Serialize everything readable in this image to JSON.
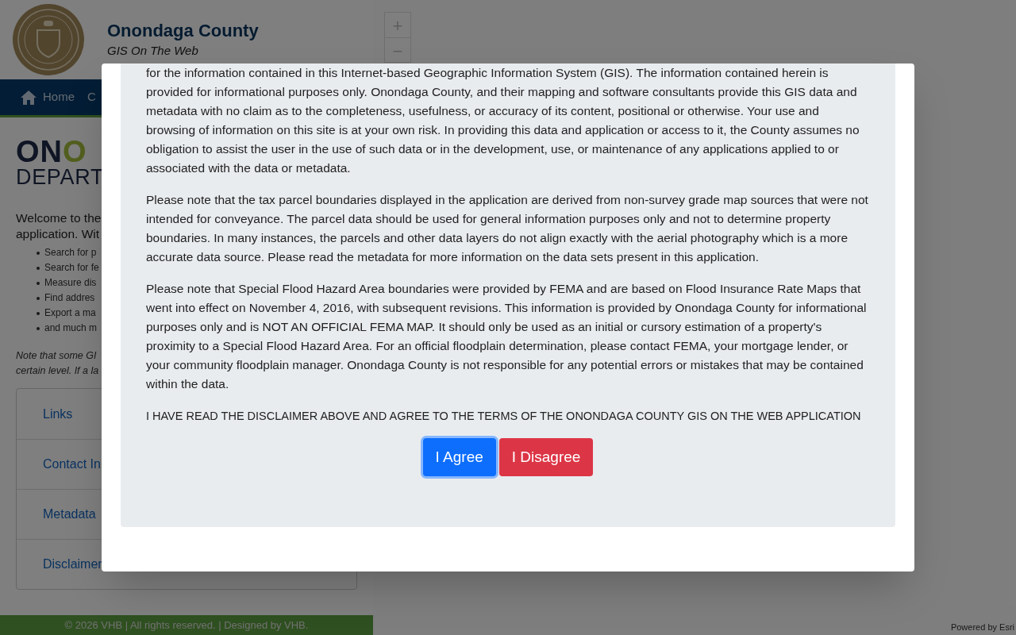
{
  "header": {
    "title": "Onondaga County",
    "subtitle": "GIS On The Web"
  },
  "nav": [
    "Home",
    "C"
  ],
  "map_zoom": [
    "+",
    "−"
  ],
  "sidebar": {
    "logo_parts": [
      "ON",
      "O"
    ],
    "logo_subtitle": "DEPART",
    "welcome_lines": [
      "Welcome to the",
      "application. Wit"
    ],
    "features": [
      "Search for p",
      "Search for fe",
      "Measure dis",
      "Find addres",
      "Export a ma",
      "and much m"
    ],
    "note_lines": [
      "Note that some GI",
      "certain level. If a la"
    ],
    "accordion": [
      "Links",
      "Contact In",
      "Metadata",
      "Disclaimer"
    ]
  },
  "footer": "© 2026 VHB | All rights reserved. | Designed by VHB.",
  "attribution": "Powered by Esri",
  "modal": {
    "paragraphs": [
      "for the information contained in this Internet-based Geographic Information System (GIS). The information contained herein is provided for informational purposes only. Onondaga County, and their mapping and software consultants provide this GIS data and metadata with no claim as to the completeness, usefulness, or accuracy of its content, positional or otherwise. Your use and browsing of information on this site is at your own risk. In providing this data and application or access to it, the County assumes no obligation to assist the user in the use of such data or in the development, use, or maintenance of any applications applied to or associated with the data or metadata.",
      "Please note that the tax parcel boundaries displayed in the application are derived from non-survey grade map sources that were not intended for conveyance. The parcel data should be used for general information purposes only and not to determine property boundaries. In many instances, the parcels and other data layers do not align exactly with the aerial photography which is a more accurate data source. Please read the metadata for more information on the data sets present in this application.",
      "Please note that Special Flood Hazard Area boundaries were provided by FEMA and are based on Flood Insurance Rate Maps that went into effect on November 4, 2016, with subsequent revisions. This information is provided by Onondaga County for informational purposes only and is NOT AN OFFICIAL FEMA MAP. It should only be used as an initial or cursory estimation of a property's proximity to a Special Flood Hazard Area. For an official floodplain determination, please contact FEMA, your mortgage lender, or your community floodplain manager. Onondaga County is not responsible for any potential errors or mistakes that may be contained within the data."
    ],
    "confirmation": "I HAVE READ THE DISCLAIMER ABOVE AND AGREE TO THE TERMS OF THE ONONDAGA COUNTY GIS ON THE WEB APPLICATION",
    "buttons": [
      {
        "label": "I Agree",
        "kind": "primary",
        "focused": true
      },
      {
        "label": "I Disagree",
        "kind": "danger",
        "focused": false
      }
    ]
  }
}
